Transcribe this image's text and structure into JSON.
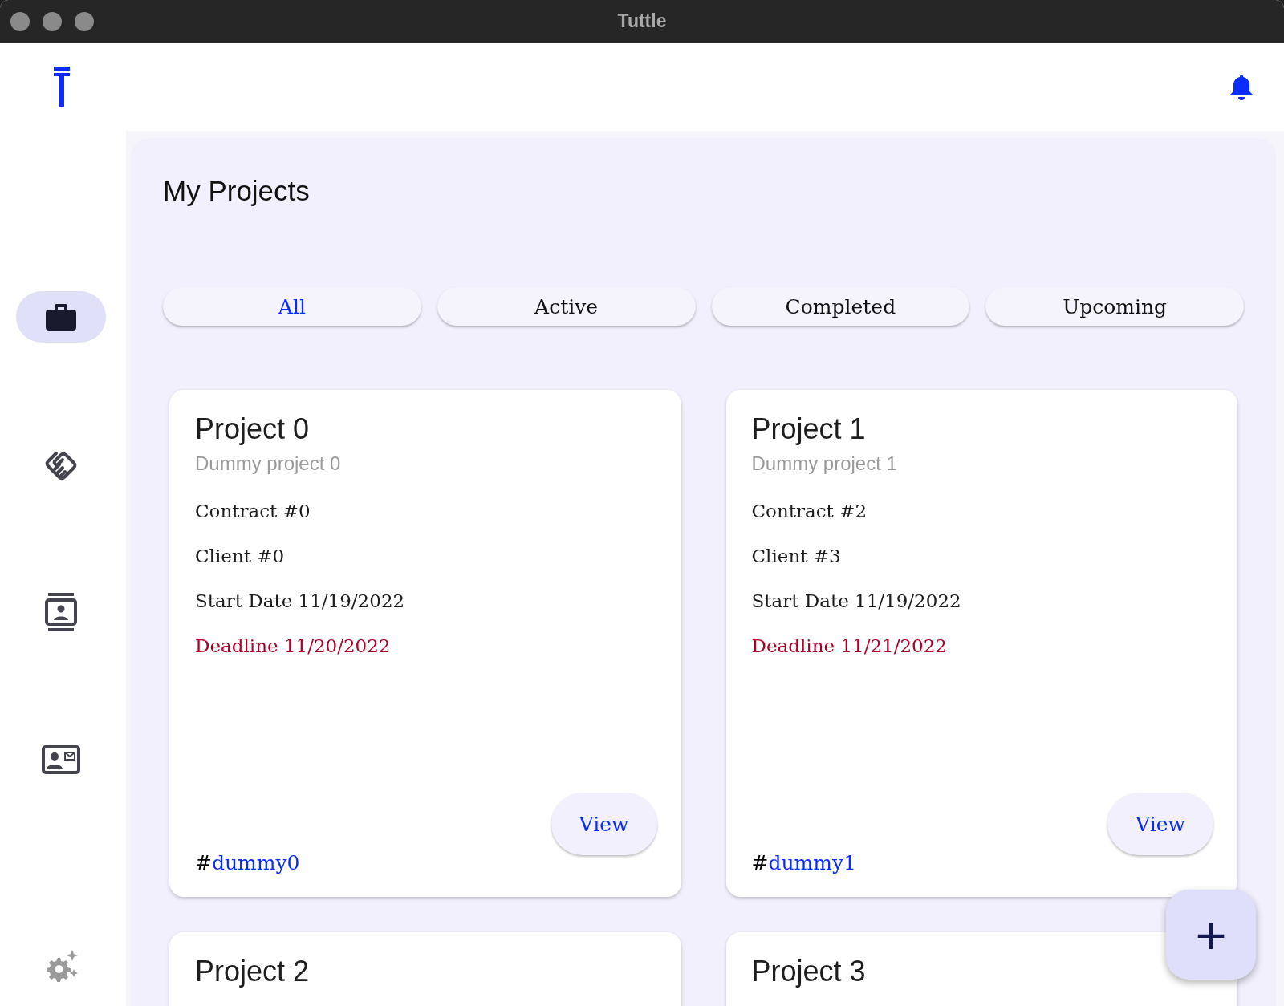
{
  "window": {
    "title": "Tuttle"
  },
  "sidebar": {
    "items": [
      {
        "kind": "briefcase",
        "selected": true
      },
      {
        "kind": "handshake",
        "selected": false
      },
      {
        "kind": "contacts",
        "selected": false
      },
      {
        "kind": "contact-card",
        "selected": false
      }
    ]
  },
  "page": {
    "title": "My Projects"
  },
  "filters": [
    {
      "label": "All",
      "selected": true
    },
    {
      "label": "Active",
      "selected": false
    },
    {
      "label": "Completed",
      "selected": false
    },
    {
      "label": "Upcoming",
      "selected": false
    }
  ],
  "projects": [
    {
      "title": "Project 0",
      "subtitle": "Dummy project 0",
      "contract": "Contract #0",
      "client": "Client #0",
      "start": "Start Date 11/19/2022",
      "deadline": "Deadline 11/20/2022",
      "tag_prefix": "#",
      "tag": "dummy0",
      "button": "View"
    },
    {
      "title": "Project 1",
      "subtitle": "Dummy project 1",
      "contract": "Contract #2",
      "client": "Client #3",
      "start": "Start Date 11/19/2022",
      "deadline": "Deadline 11/21/2022",
      "tag_prefix": "#",
      "tag": "dummy1",
      "button": "View"
    },
    {
      "title": "Project 2"
    },
    {
      "title": "Project 3"
    }
  ],
  "fab": {
    "label": "+"
  }
}
